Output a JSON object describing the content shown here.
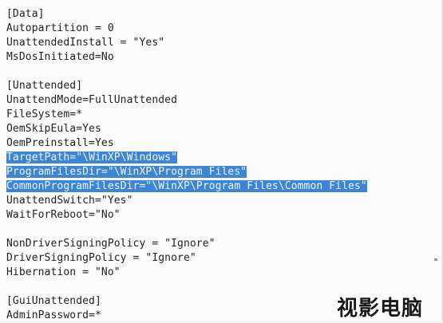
{
  "editor": {
    "lines": [
      {
        "text": "[Data]",
        "selected": false
      },
      {
        "text": "Autopartition = 0",
        "selected": false
      },
      {
        "text": "UnattendedInstall = \"Yes\"",
        "selected": false
      },
      {
        "text": "MsDosInitiated=No",
        "selected": false
      },
      {
        "text": "",
        "selected": false
      },
      {
        "text": "[Unattended]",
        "selected": false
      },
      {
        "text": "UnattendMode=FullUnattended",
        "selected": false
      },
      {
        "text": "FileSystem=*",
        "selected": false
      },
      {
        "text": "OemSkipEula=Yes",
        "selected": false
      },
      {
        "text": "OemPreinstall=Yes",
        "selected": false
      },
      {
        "text": "TargetPath=\"\\WinXP\\Windows\"",
        "selected": true
      },
      {
        "text": "ProgramFilesDir=\"\\WinXP\\Program Files\"",
        "selected": true
      },
      {
        "text": "CommonProgramFilesDir=\"\\WinXP\\Program Files\\Common Files\"",
        "selected": true
      },
      {
        "text": "UnattendSwitch=\"Yes\"",
        "selected": false
      },
      {
        "text": "WaitForReboot=\"No\"",
        "selected": false
      },
      {
        "text": "",
        "selected": false
      },
      {
        "text": "NonDriverSigningPolicy = \"Ignore\"",
        "selected": false
      },
      {
        "text": "DriverSigningPolicy = \"Ignore\"",
        "selected": false
      },
      {
        "text": "Hibernation = \"No\"",
        "selected": false
      },
      {
        "text": "",
        "selected": false
      },
      {
        "text": "[GuiUnattended]",
        "selected": false
      },
      {
        "text": "AdminPassword=*",
        "selected": false
      }
    ],
    "selection_color": "#3d86d7"
  },
  "watermark": {
    "text": "视影电脑"
  }
}
